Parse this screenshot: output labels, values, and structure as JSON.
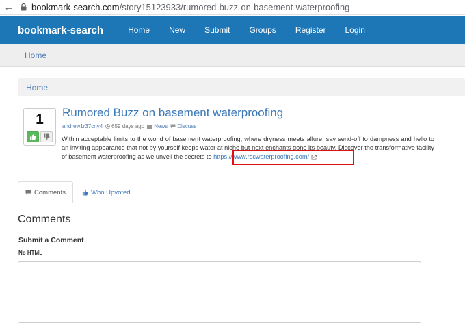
{
  "browser": {
    "url_host": "bookmark-search.com",
    "url_path": "/story15123933/rumored-buzz-on-basement-waterproofing"
  },
  "navbar": {
    "brand": "bookmark-search",
    "items": [
      "Home",
      "New",
      "Submit",
      "Groups",
      "Register",
      "Login"
    ]
  },
  "breadcrumb_top": "Home",
  "breadcrumb": "Home",
  "story": {
    "votes": "1",
    "title": "Rumored Buzz on basement waterproofing",
    "author": "andrew1r37cny4",
    "age": "659 days ago",
    "category": "News",
    "discuss": "Discuss",
    "description": "Within acceptable limits to the world of basement waterproofing, where dryness meets allure! say send-off to dampness and hello to an inviting appearance that not by yourself keeps water at niche but next enchants gone its beauty. Discover the transformative facility of basement waterproofing as we unveil the secrets to ",
    "link": "https://www.rccwaterproofing.com/"
  },
  "tabs": {
    "comments": "Comments",
    "who_upvoted": "Who Upvoted"
  },
  "comments": {
    "heading": "Comments",
    "submit_heading": "Submit a Comment",
    "no_html": "No HTML",
    "textarea_value": ""
  },
  "colors": {
    "navbar": "#1d76b6",
    "link": "#3d79b8",
    "highlight": "#e01010",
    "upvote": "#5cb85c"
  }
}
